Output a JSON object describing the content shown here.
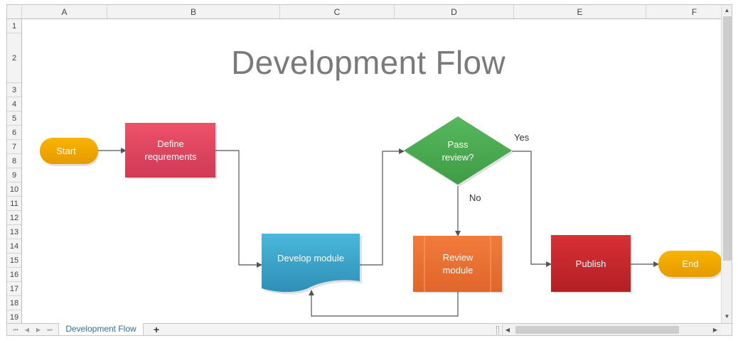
{
  "columns": [
    "A",
    "B",
    "C",
    "D",
    "E",
    "F"
  ],
  "rows": [
    "1",
    "2",
    "3",
    "4",
    "5",
    "6",
    "7",
    "8",
    "9",
    "10",
    "11",
    "12",
    "13",
    "14",
    "15",
    "16",
    "17",
    "18",
    "19"
  ],
  "title": "Development Flow",
  "flowchart": {
    "start": "Start",
    "define_line1": "Define",
    "define_line2": "requrements",
    "develop": "Develop module",
    "decision_line1": "Pass",
    "decision_line2": "review?",
    "review_line1": "Review",
    "review_line2": "module",
    "publish": "Publish",
    "end": "End",
    "yes_label": "Yes",
    "no_label": "No"
  },
  "colors": {
    "start_end": "#f2a500",
    "define": "#e04a63",
    "develop": "#3fa9cf",
    "decision": "#46ab4e",
    "review": "#ee7131",
    "publish": "#c6262c",
    "connector": "#555555"
  },
  "sheet_tab": "Development Flow",
  "add_sheet_icon": "+",
  "icons": {
    "scroll_up": "▲",
    "scroll_down": "▼",
    "scroll_left": "◀",
    "scroll_right": "▶",
    "first_sheet": "⏮",
    "prev_sheet": "◀",
    "next_sheet": "▶",
    "last_sheet": "⏭"
  }
}
